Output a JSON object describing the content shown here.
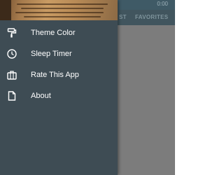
{
  "header": {
    "time": "0:00",
    "tabs": [
      "ST",
      "FAVORITES"
    ]
  },
  "drawer": {
    "items": [
      {
        "label": "Theme Color",
        "icon": "paint-roller-icon"
      },
      {
        "label": "Sleep Timer",
        "icon": "clock-icon"
      },
      {
        "label": "Rate This App",
        "icon": "briefcase-icon"
      },
      {
        "label": "About",
        "icon": "document-icon"
      }
    ]
  },
  "colors": {
    "drawer_background": "#3e4c54",
    "header_background": "#3f5a66",
    "scrim": "#7c7c7c",
    "text": "#ffffff"
  }
}
